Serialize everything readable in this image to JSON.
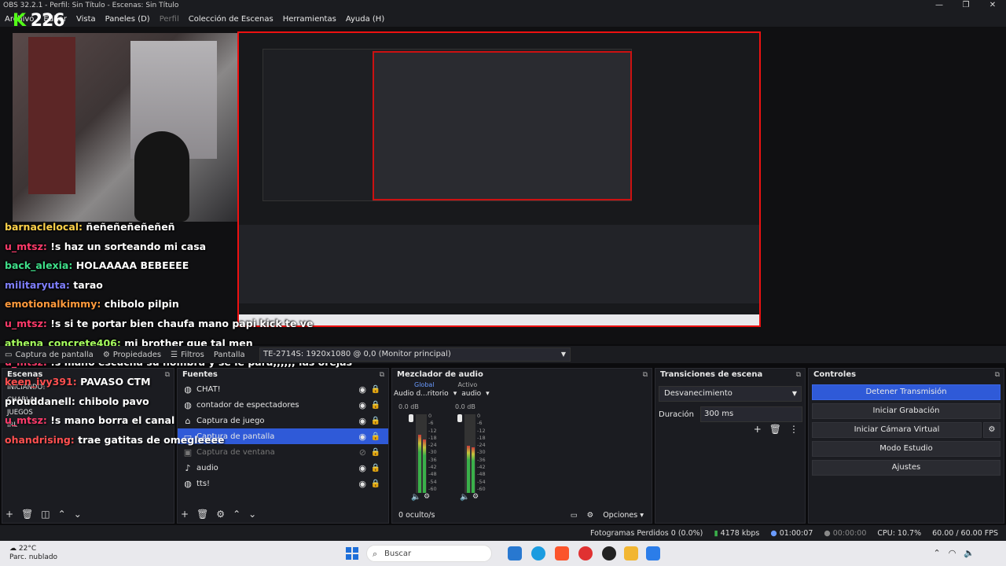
{
  "window": {
    "title": "OBS 32.2.1 - Perfil: Sin Título - Escenas: Sin Título"
  },
  "overlay": {
    "kick_count": "226"
  },
  "menu": {
    "items": [
      {
        "label": "Archivo",
        "disabled": false
      },
      {
        "label": "Editar",
        "disabled": false
      },
      {
        "label": "Vista",
        "disabled": false
      },
      {
        "label": "Paneles (D)",
        "disabled": false
      },
      {
        "label": "Perfil",
        "disabled": true
      },
      {
        "label": "Colección de Escenas",
        "disabled": false
      },
      {
        "label": "Herramientas",
        "disabled": false
      },
      {
        "label": "Ayuda (H)",
        "disabled": false
      }
    ]
  },
  "chat": [
    {
      "user": "barnaclelocal:",
      "msg": "ñeñeñeñeñeñeñ",
      "cls": "u1"
    },
    {
      "user": "u_mtsz:",
      "msg": "!s haz un sorteando mi casa",
      "cls": "u2"
    },
    {
      "user": "back_alexia:",
      "msg": "HOLAAAAA BEBEEEE",
      "cls": "u3"
    },
    {
      "user": "militaryuta:",
      "msg": "tarao",
      "cls": "u4"
    },
    {
      "user": "emotionalkimmy:",
      "msg": "chibolo pilpin",
      "cls": "u5"
    },
    {
      "user": "u_mtsz:",
      "msg": "!s si te portar bien chaufa mano papi kick te ve",
      "cls": "u2"
    },
    {
      "user": "athena_concrete406:",
      "msg": "mi brother que tal men",
      "cls": "u6"
    },
    {
      "user": "u_mtsz:",
      "msg": "!s mano escucha su nombra y se le para,,,,,, las orejas",
      "cls": "u2"
    }
  ],
  "chat_lower": [
    {
      "user": "keen_ivy391:",
      "msg": "PAVASO CTM",
      "cls": "u7"
    },
    {
      "user": "prouddanell:",
      "msg": "chibolo pavo",
      "cls": "msg"
    },
    {
      "user": "u_mtsz:",
      "msg": "!s mano borra el canal",
      "cls": "u2"
    },
    {
      "user": "ohandrising:",
      "msg": "trae gatitas de omegleeee",
      "cls": "u7"
    }
  ],
  "source_bar": {
    "source_name": "Captura de pantalla",
    "properties": "Propiedades",
    "filters": "Filtros",
    "screen_label": "Pantalla",
    "screen_value": "TE-2714S: 1920x1080 @ 0,0 (Monitor principal)"
  },
  "scenes": {
    "title": "Escenas",
    "items": [
      "INICIANDO!",
      "CHARLA",
      "JUEGOS",
      "IRL"
    ]
  },
  "sources": {
    "title": "Fuentes",
    "items": [
      {
        "label": "CHAT!",
        "icon": "globe-icon",
        "glyph": "◍",
        "selected": false,
        "hidden": false
      },
      {
        "label": "contador de espectadores",
        "icon": "globe-icon",
        "glyph": "◍",
        "selected": false,
        "hidden": false
      },
      {
        "label": "Captura de juego",
        "icon": "gamepad-icon",
        "glyph": "⌂",
        "selected": false,
        "hidden": false
      },
      {
        "label": "Captura de pantalla",
        "icon": "monitor-icon",
        "glyph": "▭",
        "selected": true,
        "hidden": false
      },
      {
        "label": "Captura de ventana",
        "icon": "window-icon",
        "glyph": "▣",
        "selected": false,
        "hidden": true
      },
      {
        "label": "audio",
        "icon": "microphone-icon",
        "glyph": "♪",
        "selected": false,
        "hidden": false
      },
      {
        "label": "tts!",
        "icon": "globe-icon",
        "glyph": "◍",
        "selected": false,
        "hidden": false
      }
    ]
  },
  "mixer": {
    "title": "Mezclador de audio",
    "tab_global": "Global",
    "tab_active": "Activo",
    "channels": [
      {
        "name": "Audio d...ritorio",
        "db": "0.0 dB"
      },
      {
        "name": "audio",
        "db": "0.0 dB"
      }
    ],
    "scale": [
      "0",
      "-6",
      "-12",
      "-18",
      "-24",
      "-30",
      "-36",
      "-42",
      "-48",
      "-54",
      "-60"
    ],
    "hidden_count": "0 oculto/s",
    "options": "Opciones"
  },
  "transitions": {
    "title": "Transiciones de escena",
    "selected": "Desvanecimiento",
    "duration_label": "Duración",
    "duration_value": "300 ms"
  },
  "controls": {
    "title": "Controles",
    "stop_stream": "Detener Transmisión",
    "start_recording": "Iniciar Grabación",
    "start_virtual_cam": "Iniciar Cámara Virtual",
    "studio_mode": "Modo Estudio",
    "settings": "Ajustes"
  },
  "status": {
    "dropped_frames": "Fotogramas Perdidos 0 (0.0%)",
    "bitrate": "4178 kbps",
    "stream_time": "01:00:07",
    "rec_time": "00:00:00",
    "cpu": "CPU: 10.7%",
    "fps": "60.00 / 60.00 FPS"
  },
  "taskbar": {
    "temp": "22°C",
    "weather": "Parc. nublado",
    "search": "Buscar"
  },
  "colors": {
    "accent": "#2f5ad8",
    "live_border": "#ee1111"
  }
}
